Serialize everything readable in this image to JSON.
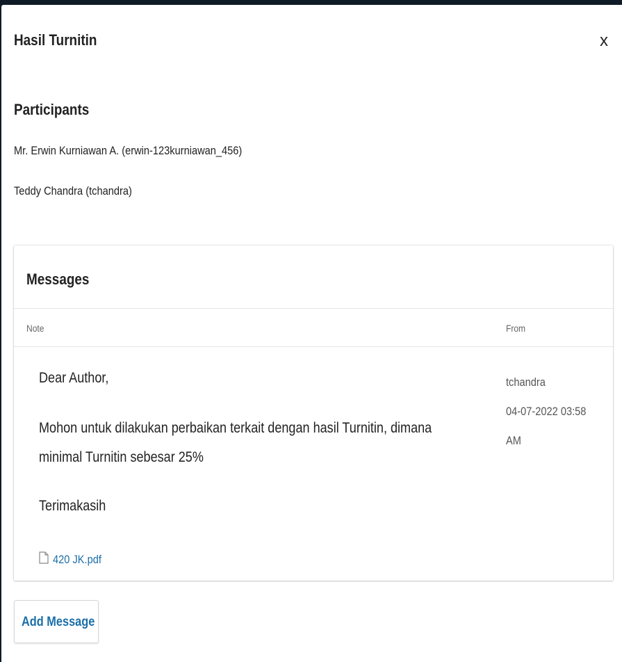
{
  "modal": {
    "title": "Hasil Turnitin",
    "close_label": "x"
  },
  "participants": {
    "heading": "Participants",
    "items": [
      "Mr. Erwin Kurniawan A. (erwin-123kurniawan_456)",
      "Teddy Chandra (tchandra)"
    ]
  },
  "messages": {
    "heading": "Messages",
    "columns": {
      "note": "Note",
      "from": "From"
    },
    "rows": [
      {
        "greeting": "Dear Author,",
        "body_line1": "Mohon untuk dilakukan perbaikan terkait dengan hasil Turnitin, dimana",
        "body_line2": "minimal Turnitin sebesar 25%",
        "closing": "Terimakasih",
        "attachment": "420 JK.pdf",
        "from_user": "tchandra",
        "from_date": "04-07-2022 03:58",
        "from_time_suffix": "AM"
      }
    ]
  },
  "actions": {
    "add_message": "Add Message"
  },
  "colors": {
    "link": "#1b6fa8",
    "backdrop": "#0f1b26"
  },
  "icons": {
    "attachment": "file-icon",
    "close": "close-icon"
  }
}
